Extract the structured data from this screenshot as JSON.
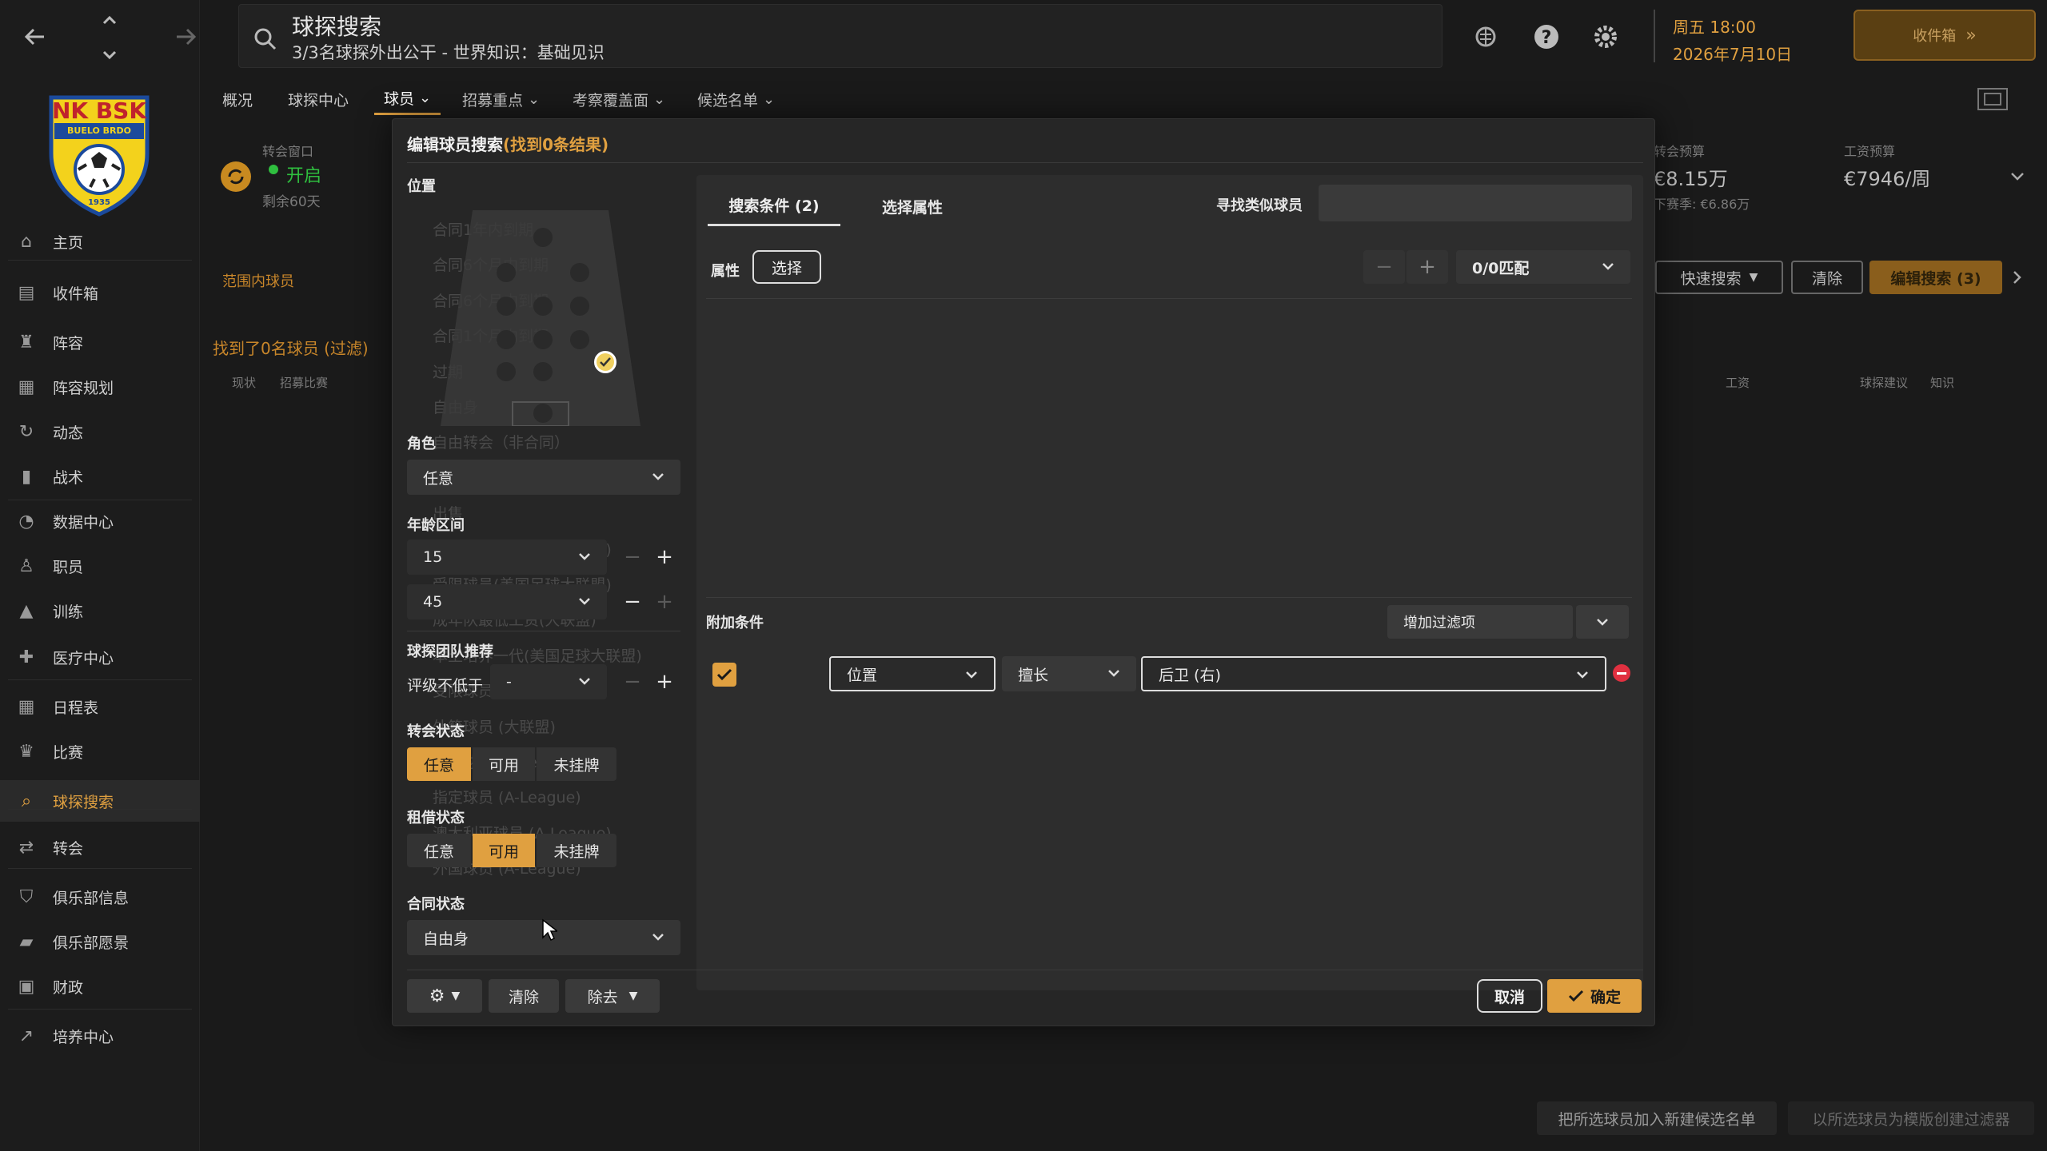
{
  "topbar": {
    "search_title": "球探搜索",
    "search_subtitle": "3/3名球探外出公干 - 世界知识：基础见识",
    "datetime_day": "周五 18:00",
    "datetime_date": "2026年7月10日",
    "inbox_button": "收件箱"
  },
  "subnav": [
    "概况",
    "球探中心",
    "球员",
    "招募重点",
    "考察覆盖面",
    "候选名单"
  ],
  "club": {
    "logo_text": "NK BSK",
    "logo_sub": "BUELO BRDO",
    "logo_year": "1935"
  },
  "transfer_window": {
    "label": "转会窗口",
    "status": "开启",
    "remaining": "剩余60天"
  },
  "budget": {
    "transfer_label": "转会预算",
    "transfer_value": "€8.15万",
    "wage_label": "工资预算",
    "wage_value": "€7946/周",
    "off_season": "下赛季: €6.86万"
  },
  "sidebar": {
    "items": [
      {
        "label": "主页",
        "icon": "home-icon"
      },
      {
        "label": "收件箱",
        "icon": "inbox-icon"
      },
      {
        "label": "阵容",
        "icon": "shirt-icon"
      },
      {
        "label": "阵容规划",
        "icon": "clipboard-icon"
      },
      {
        "label": "动态",
        "icon": "refresh-icon"
      },
      {
        "label": "战术",
        "icon": "tactics-icon"
      },
      {
        "label": "数据中心",
        "icon": "data-icon"
      },
      {
        "label": "职员",
        "icon": "staff-icon"
      },
      {
        "label": "训练",
        "icon": "training-icon"
      },
      {
        "label": "医疗中心",
        "icon": "medical-icon"
      },
      {
        "label": "日程表",
        "icon": "calendar-icon"
      },
      {
        "label": "比赛",
        "icon": "trophy-icon"
      },
      {
        "label": "球探搜索",
        "icon": "search-icon"
      },
      {
        "label": "转会",
        "icon": "transfer-icon"
      },
      {
        "label": "俱乐部信息",
        "icon": "shield-icon"
      },
      {
        "label": "俱乐部愿景",
        "icon": "briefcase-icon"
      },
      {
        "label": "财政",
        "icon": "money-icon"
      },
      {
        "label": "培养中心",
        "icon": "growth-icon"
      }
    ]
  },
  "background": {
    "range_players": "范围内球员",
    "found_players": "找到了0名球员 (过滤)",
    "col_status": "现状",
    "col_recruit": "招募比赛",
    "col_wage": "工资",
    "col_advice": "球探建议",
    "col_knowledge": "知识",
    "quick_search": "快速搜索",
    "clear": "清除",
    "edit_search": "编辑搜索 (3)",
    "add_shortlist": "把所选球员加入新建候选名单",
    "create_filter": "以所选球员为模版创建过滤器"
  },
  "modal": {
    "title": "编辑球员搜索",
    "result": "(找到0条结果)",
    "position_label": "位置",
    "role_label": "角色",
    "role_value": "任意",
    "age_label": "年龄区间",
    "age_min": "15",
    "age_max": "45",
    "team_rec_label": "球探团队推荐",
    "rating_label": "评级不低于",
    "rating_value": "-",
    "transfer_status_label": "转会状态",
    "transfer_options": [
      "任意",
      "可用",
      "未挂牌"
    ],
    "loan_status_label": "租借状态",
    "loan_options": [
      "任意",
      "可用",
      "未挂牌"
    ],
    "contract_label": "合同状态",
    "contract_value": "自由身",
    "tab_criteria": "搜索条件 (2)",
    "tab_attributes": "选择属性",
    "find_similar_label": "寻找类似球员",
    "attr_label": "属性",
    "attr_select": "选择",
    "match_value": "0/0匹配",
    "extra_label": "附加条件",
    "add_filter": "增加过滤项",
    "filter_field": "位置",
    "filter_op": "擅长",
    "filter_value": "后卫 (右)",
    "clear_btn": "清除",
    "remove_btn": "除去",
    "cancel_btn": "取消",
    "confirm_btn": "确定"
  },
  "ghost_list": [
    "合同1年内到期",
    "合同6个月内到期",
    "合同6个月内到期",
    "合同1个月内到期",
    "过期",
    "自由身",
    "自由转会（非合同）",
    "非合同",
    "出售",
    "特殊球员(美国足球大联盟)",
    "受限球员(美国足球大联盟)",
    "成年队最低工资(大联盟)",
    "本土培养一代(美国足球大联盟)",
    "受限球员(大联盟)",
    "外籍球员 (大联盟)",
    "指定球员 (A-League)",
    "指定球员 (A-League)",
    "澳大利亚球员 (A-League)",
    "外国球员 (A-League)"
  ]
}
